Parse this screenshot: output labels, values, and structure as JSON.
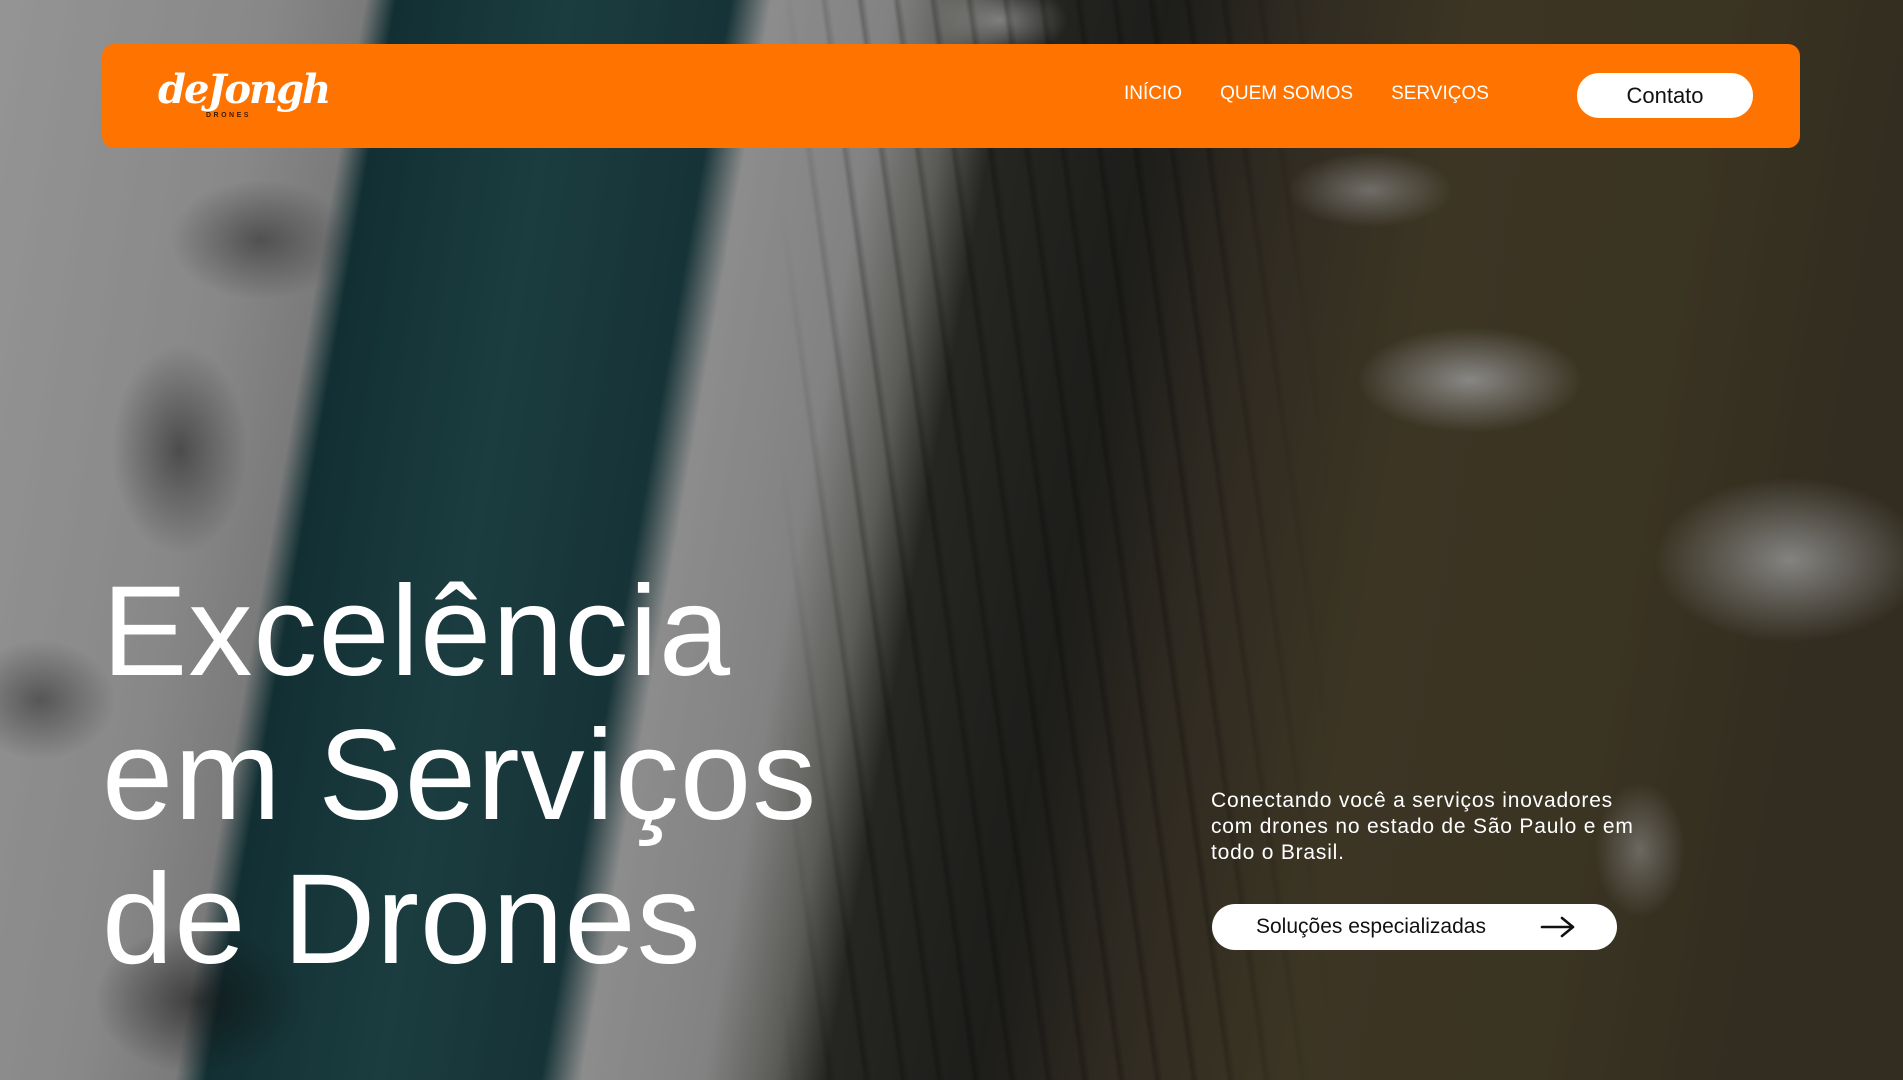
{
  "brand": {
    "logo_text": "deJongh",
    "logo_subtext": "DRONES",
    "accent_color": "#ff7300"
  },
  "nav": {
    "items": [
      {
        "label": "INÍCIO"
      },
      {
        "label": "QUEM SOMOS"
      },
      {
        "label": "SERVIÇOS"
      }
    ],
    "contact_label": "Contato"
  },
  "hero": {
    "headline_lines": [
      "Excelência",
      "em Serviços",
      "de Drones"
    ],
    "subtext": "Conectando você a serviços inovadores com drones no estado de São Paulo e em todo o Brasil.",
    "cta_label": "Soluções especializadas",
    "cta_icon": "arrow-right-icon",
    "background": "aerial-canyon-photo"
  }
}
